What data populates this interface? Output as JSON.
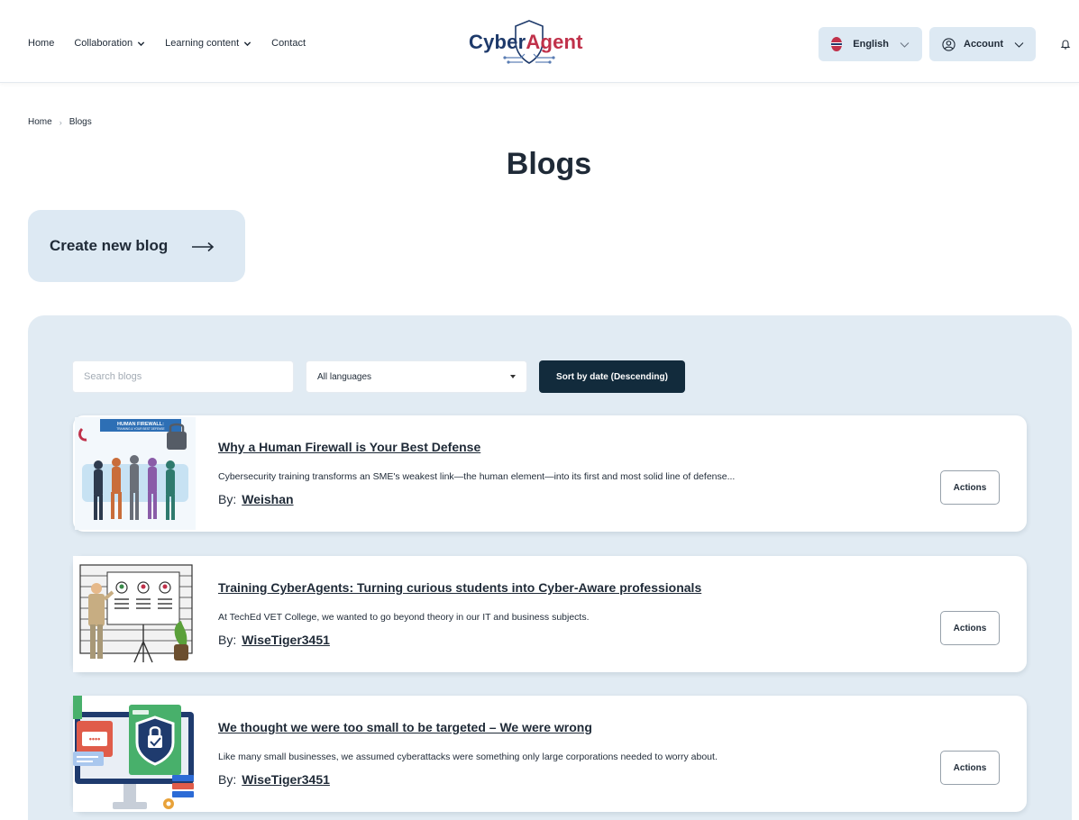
{
  "header": {
    "nav": {
      "home": "Home",
      "collaboration": "Collaboration",
      "learning_content": "Learning content",
      "contact": "Contact"
    },
    "logo": {
      "part1": "Cyber",
      "part2": "Agent"
    },
    "language": "English",
    "account": "Account"
  },
  "breadcrumb": {
    "home": "Home",
    "current": "Blogs"
  },
  "page": {
    "title": "Blogs"
  },
  "create": {
    "label": "Create new blog"
  },
  "filters": {
    "search_placeholder": "Search blogs",
    "language_selected": "All languages",
    "sort_label": "Sort by date (Descending)"
  },
  "blogs": [
    {
      "title": "Why a Human Firewall is Your Best Defense",
      "excerpt": "Cybersecurity training transforms an SME's weakest link—the human element—into its first and most solid line of defense...",
      "by_label": "By:",
      "author": "Weishan",
      "actions_label": "Actions",
      "thumb_banner": "HUMAN FIREWALL:",
      "thumb_sub": "TRAINING & YOUR BEST DEFENSE"
    },
    {
      "title": "Training CyberAgents: Turning curious students into Cyber-Aware professionals",
      "excerpt": "At TechEd VET College, we wanted to go beyond theory in our IT and business subjects.",
      "by_label": "By:",
      "author": "WiseTiger3451",
      "actions_label": "Actions"
    },
    {
      "title": "We thought we were too small to be targeted – We were wrong",
      "excerpt": "Like many small businesses, we assumed cyberattacks were something only large corporations needed to worry about.",
      "by_label": "By:",
      "author": "WiseTiger3451",
      "actions_label": "Actions"
    }
  ],
  "colors": {
    "accent_dark": "#122b3c",
    "panel_bg": "#e1ebf3",
    "pill_bg": "#dde9f3",
    "logo_blue": "#1e3a6b",
    "logo_red": "#c0314a"
  }
}
